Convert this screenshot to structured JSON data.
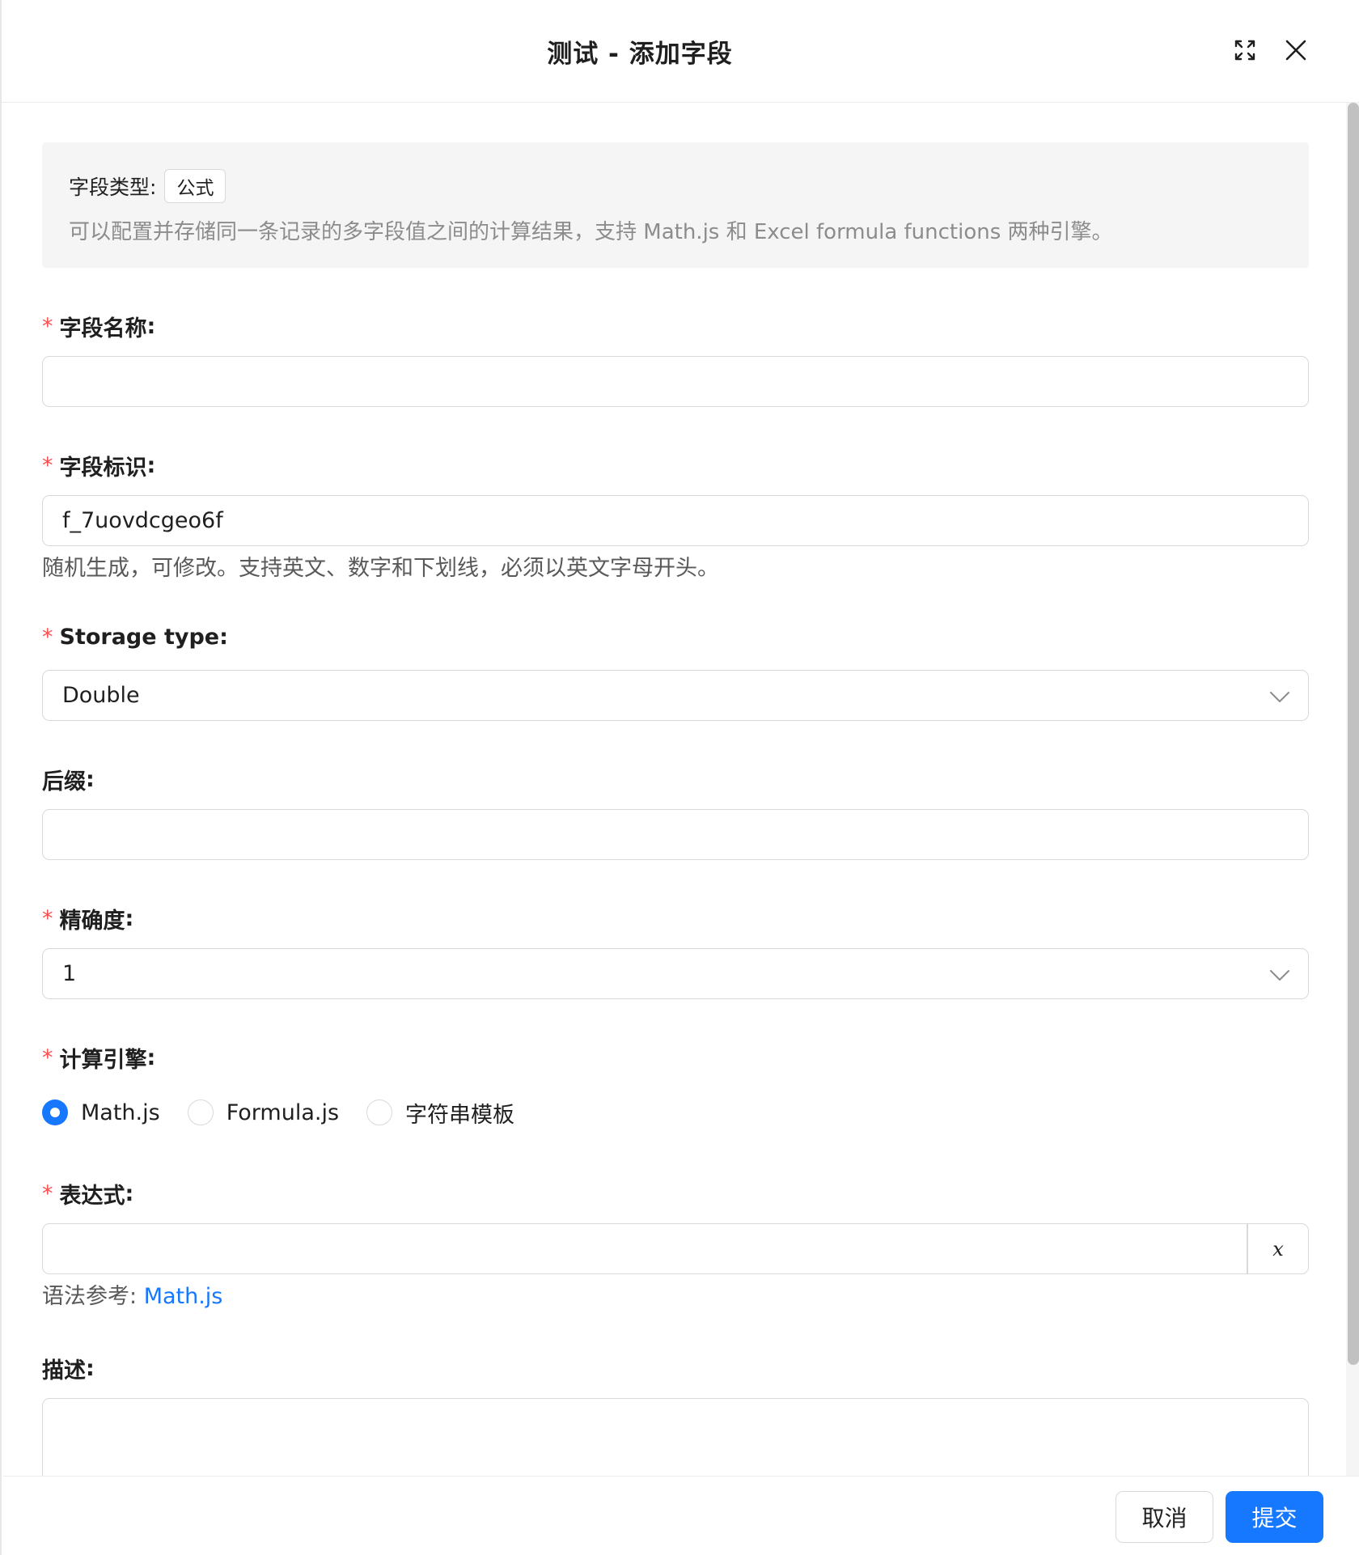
{
  "header": {
    "title": "测试 - 添加字段"
  },
  "info": {
    "field_type_label": "字段类型:",
    "field_type_value": "公式",
    "description": "可以配置并存储同一条记录的多字段值之间的计算结果，支持 Math.js 和 Excel formula functions 两种引擎。"
  },
  "form": {
    "field_name": {
      "label": "字段名称",
      "required": true,
      "value": ""
    },
    "field_id": {
      "label": "字段标识",
      "required": true,
      "value": "f_7uovdcgeo6f",
      "help": "随机生成，可修改。支持英文、数字和下划线，必须以英文字母开头。"
    },
    "storage_type": {
      "label": "Storage type",
      "required": true,
      "value": "Double"
    },
    "suffix": {
      "label": "后缀",
      "required": false,
      "value": ""
    },
    "precision": {
      "label": "精确度",
      "required": true,
      "value": "1"
    },
    "engine": {
      "label": "计算引擎",
      "required": true,
      "options": [
        "Math.js",
        "Formula.js",
        "字符串模板"
      ],
      "selected": "Math.js"
    },
    "expression": {
      "label": "表达式",
      "required": true,
      "value": "",
      "addon": "x",
      "help_prefix": "语法参考: ",
      "help_link": "Math.js"
    },
    "description": {
      "label": "描述",
      "required": false,
      "value": ""
    }
  },
  "footer": {
    "cancel_label": "取消",
    "submit_label": "提交"
  },
  "colors": {
    "primary": "#1677ff",
    "required_mark": "#ff4d4f",
    "border": "#d9d9d9",
    "info_bg": "#f5f5f5"
  },
  "icons": {
    "expand": "expand-icon",
    "close": "close-icon",
    "select_arrow": "chevron-down-icon"
  }
}
